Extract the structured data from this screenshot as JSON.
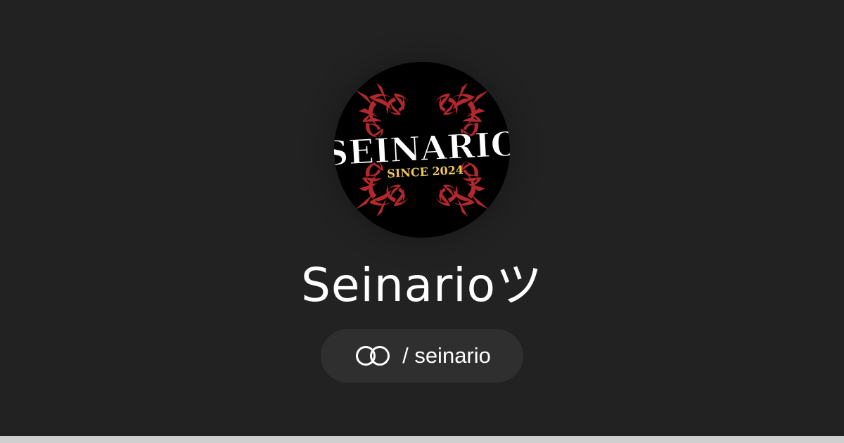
{
  "profile": {
    "logo_text": "SEINARIO",
    "logo_subtext": "SINCE 2024",
    "display_name": "Seinarioツ",
    "handle": "/ seinario"
  },
  "icons": {
    "avatar": "seinario-logo-avatar",
    "link": "interlocking-rings-icon"
  },
  "colors": {
    "background": "#222222",
    "pill": "#2f2f2f",
    "logo_ornament": "#b3282d",
    "logo_subtext": "#f0c85a",
    "text": "#ffffff"
  }
}
